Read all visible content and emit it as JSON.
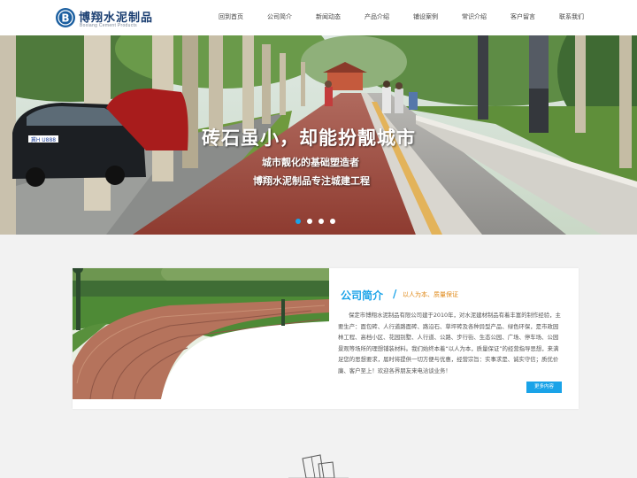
{
  "brand": {
    "name": "博翔水泥制品",
    "subtitle": "Boxiang Cement Products",
    "logo_icon": "b-letter-logo-icon",
    "color": "#1b3f72"
  },
  "nav": {
    "items": [
      "回到首页",
      "公司简介",
      "新闻动态",
      "产品介绍",
      "铺设案例",
      "常识介绍",
      "客户留言",
      "联系我们"
    ]
  },
  "banner": {
    "headline": "砖石虽小，却能扮靓城市",
    "line1": "城市靓化的基础塑造者",
    "line2": "博翔水泥制品专注城建工程",
    "car_plate": "冀H U888",
    "slides": 4,
    "active_slide": 1,
    "active_dot_color": "#1aa3e8"
  },
  "about": {
    "title": "公司简介",
    "slash": "/",
    "tagline": "以人为本、质量保证",
    "text": "保定市博翔水泥制品有限公司建于2010年，对水泥建材制品有着丰富的制作经验，主要生产：面包砖、人行道路面砖、路沿石、草坪砖及各种异型产品、绿色环保，是市政园林工程、高档小区、花园别墅、人行道、公路、步行街、生态公园、广场、停车场、公园景观等场所的理想铺装材料。我们始终本着“以人为本，质量保证”的经营指导思想，来满足您的思想要求，届时将提供一切方便与优惠，经营宗旨：实事求是、诚实守信；质优价廉、客户至上！欢迎各界朋友来电洽谈业务！",
    "more_label": "更多内容",
    "accent_color": "#1aa3e8",
    "tagline_color": "#e08a1a"
  },
  "footer_icon": "building-outline-icon"
}
